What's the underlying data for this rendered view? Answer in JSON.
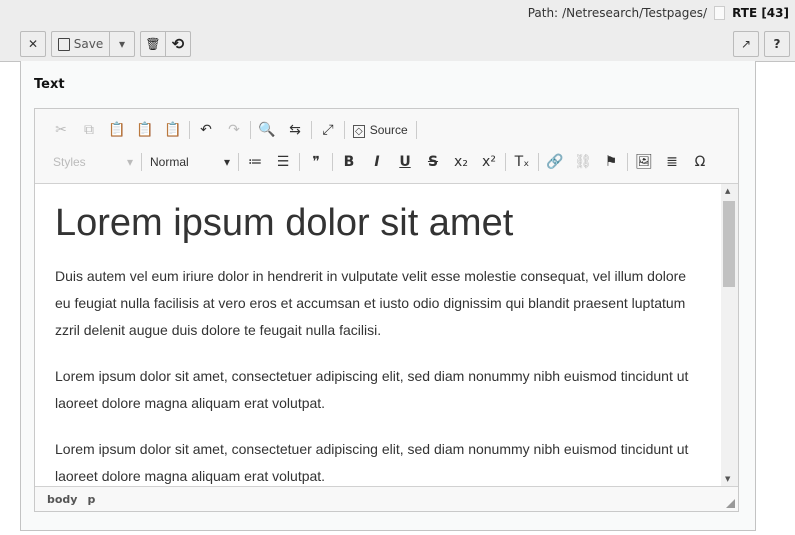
{
  "header": {
    "path_label": "Path:",
    "path": "/Netresearch/Testpages/",
    "record": "RTE [43]",
    "buttons": {
      "close": "✕",
      "save": "Save",
      "dropdown": "▾",
      "delete": "🗑",
      "history": "⟲",
      "open_new": "↗",
      "help": "?"
    }
  },
  "field": {
    "label": "Text"
  },
  "toolbar": {
    "row1": [
      {
        "icon": "cut-icon",
        "glyph": "✂",
        "disabled": true
      },
      {
        "icon": "copy-icon",
        "glyph": "⧉",
        "disabled": true
      },
      {
        "icon": "paste-icon",
        "glyph": "📋"
      },
      {
        "icon": "paste-text-icon",
        "glyph": "📋"
      },
      {
        "icon": "paste-word-icon",
        "glyph": "📋"
      },
      {
        "sep": true
      },
      {
        "icon": "undo-icon",
        "glyph": "↶"
      },
      {
        "icon": "redo-icon",
        "glyph": "↷",
        "disabled": true
      },
      {
        "sep": true
      },
      {
        "icon": "find-icon",
        "glyph": "🔍"
      },
      {
        "icon": "replace-icon",
        "glyph": "⇆"
      },
      {
        "sep": true
      },
      {
        "icon": "maximize-icon",
        "glyph": "⤢"
      },
      {
        "sep": true
      }
    ],
    "source_label": "Source",
    "styles_label": "Styles",
    "format_label": "Normal",
    "row2": [
      {
        "icon": "numbered-list-icon",
        "glyph": "≔"
      },
      {
        "icon": "bulleted-list-icon",
        "glyph": "☰"
      },
      {
        "sep": true
      },
      {
        "icon": "blockquote-icon",
        "glyph": "❞"
      },
      {
        "sep": true
      },
      {
        "icon": "bold-icon",
        "glyph": "B"
      },
      {
        "icon": "italic-icon",
        "glyph": "I"
      },
      {
        "icon": "underline-icon",
        "glyph": "U"
      },
      {
        "icon": "strikethrough-icon",
        "glyph": "S"
      },
      {
        "icon": "subscript-icon",
        "glyph": "x₂"
      },
      {
        "icon": "superscript-icon",
        "glyph": "x²"
      },
      {
        "sep": true
      },
      {
        "icon": "remove-format-icon",
        "glyph": "Tₓ"
      },
      {
        "sep": true
      },
      {
        "icon": "link-icon",
        "glyph": "🔗"
      },
      {
        "icon": "unlink-icon",
        "glyph": "⛓",
        "disabled": true
      },
      {
        "icon": "anchor-icon",
        "glyph": "⚑"
      },
      {
        "sep": true
      },
      {
        "icon": "image-icon",
        "glyph": "🖼"
      },
      {
        "icon": "horizontal-rule-icon",
        "glyph": "≣"
      },
      {
        "icon": "special-char-icon",
        "glyph": "Ω"
      }
    ]
  },
  "content": {
    "heading": "Lorem ipsum dolor sit amet",
    "paragraphs": [
      "Duis autem vel eum iriure dolor in hendrerit in vulputate velit esse molestie consequat, vel illum dolore eu feugiat nulla facilisis at vero eros et accumsan et iusto odio dignissim qui blandit praesent luptatum zzril delenit augue duis dolore te feugait nulla facilisi.",
      "Lorem ipsum dolor sit amet, consectetuer adipiscing elit, sed diam nonummy nibh euismod tincidunt ut laoreet dolore magna aliquam erat volutpat.",
      "Lorem ipsum dolor sit amet, consectetuer adipiscing elit, sed diam nonummy nibh euismod tincidunt ut laoreet dolore magna aliquam erat volutpat."
    ]
  },
  "elements_path": [
    "body",
    "p"
  ]
}
